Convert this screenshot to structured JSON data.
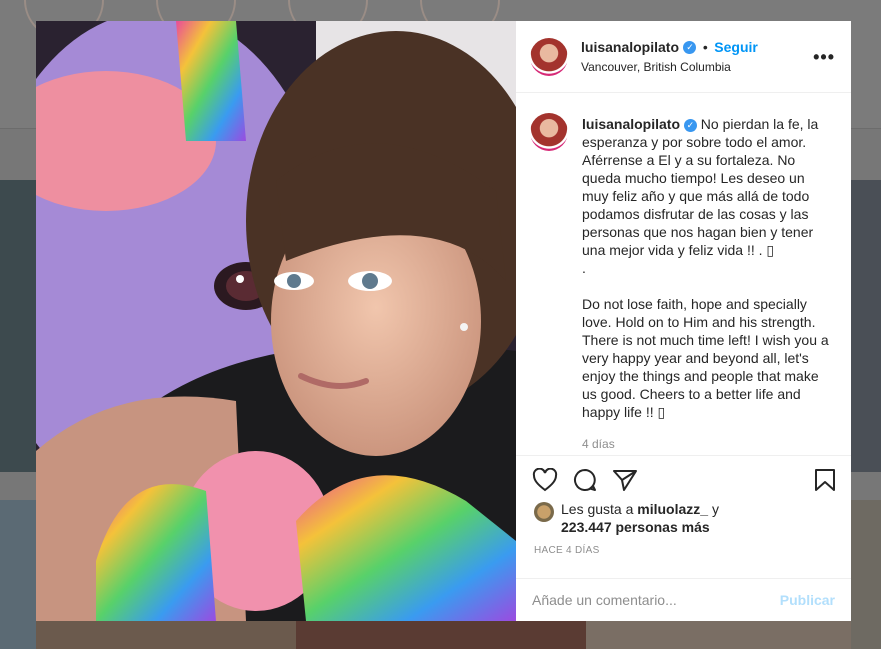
{
  "post": {
    "username": "luisanalopilato",
    "follow_label": "Seguir",
    "location": "Vancouver, British Columbia",
    "more_label": "•••",
    "bullet": "•",
    "verified_glyph": "✓",
    "caption_spanish": "No pierdan la fe, la esperanza y por sobre todo el amor. Aférrense a El y a su fortaleza. No queda mucho tiempo! Les deseo un muy feliz año y que más allá de todo podamos disfrutar de las cosas y las personas que nos hagan bien y tener una mejor vida y feliz vida !! . ▯",
    "caption_dot": ".",
    "caption_english": "Do not lose faith, hope and specially love. Hold on to Him and his strength. There is not much time left! I wish you a very happy year and beyond all, let's enjoy the things and people that make us good. Cheers to a better life and happy life !! ▯",
    "time_ago": "4 días",
    "likes_prefix": "Les gusta a",
    "likes_user": "miluolazz_",
    "likes_and": "y",
    "likes_count": "223.447 personas más",
    "hace": "HACE 4 DÍAS",
    "comment_placeholder": "Añade un comentario...",
    "publish_label": "Publicar",
    "next_glyph": "›",
    "carousel": {
      "total": 4,
      "active": 0
    }
  },
  "icons": [
    "heart-icon",
    "comment-icon",
    "share-icon",
    "bookmark-icon",
    "more-options-icon",
    "verified-icon",
    "next-arrow-icon"
  ],
  "colors": {
    "accent": "#0095f6",
    "publish_disabled": "#b2dffc",
    "verified": "#3897f0",
    "text": "#262626",
    "muted": "#8e8e8e"
  }
}
